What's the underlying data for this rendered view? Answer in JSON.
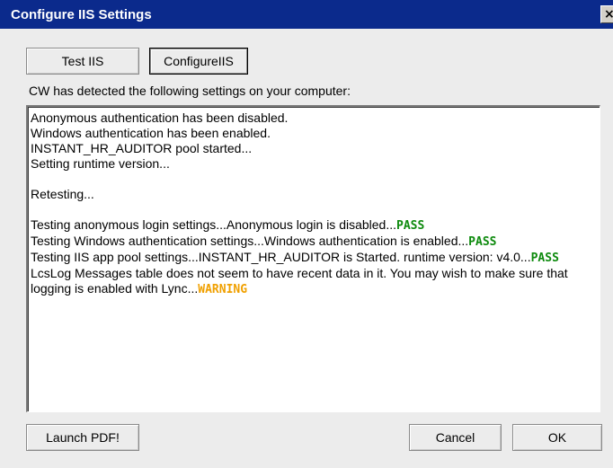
{
  "window": {
    "title": "Configure IIS Settings",
    "close_glyph": "×"
  },
  "toolbar": {
    "test_iis_label": "Test IIS",
    "configure_iis_label": "ConfigureIIS"
  },
  "detected_label": "CW has detected the following settings on your computer:",
  "log": {
    "lines": [
      {
        "text": "Anonymous authentication has been disabled."
      },
      {
        "text": "Windows authentication has been enabled."
      },
      {
        "text": "INSTANT_HR_AUDITOR pool started..."
      },
      {
        "text": "Setting runtime version..."
      },
      {
        "text": ""
      },
      {
        "text": "Retesting..."
      },
      {
        "text": ""
      },
      {
        "text": "Testing anonymous login settings...Anonymous login is disabled...",
        "status": "PASS"
      },
      {
        "text": "Testing Windows authentication settings...Windows authentication is enabled...",
        "status": "PASS"
      },
      {
        "text": "Testing IIS app pool settings...INSTANT_HR_AUDITOR is Started. runtime version: v4.0...",
        "status": "PASS"
      },
      {
        "text": "LcsLog Messages table does not seem to have recent data in it. You may wish to make sure that logging is enabled with Lync...",
        "status": "WARNING"
      }
    ]
  },
  "footer": {
    "launch_pdf_label": "Launch PDF!",
    "cancel_label": "Cancel",
    "ok_label": "OK"
  },
  "colors": {
    "titlebar": "#0b2a8c",
    "pass": "#0d8a0d",
    "warning": "#f0a000"
  }
}
